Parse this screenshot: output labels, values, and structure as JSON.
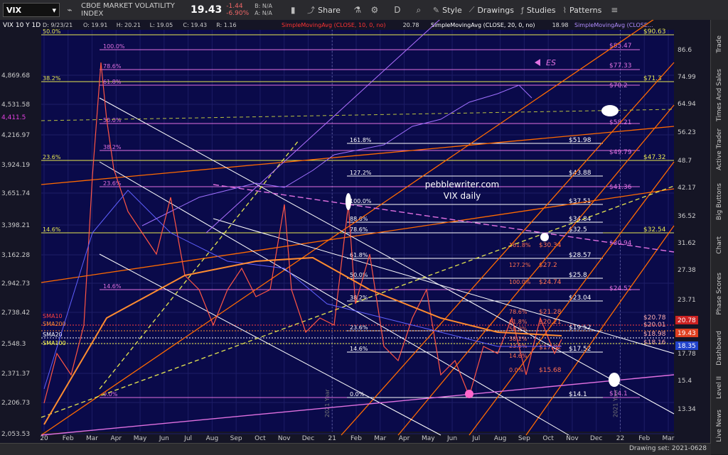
{
  "toolbar": {
    "symbol": "VIX",
    "description": "CBOE MARKET VOLATILITY INDEX",
    "price": "19.43",
    "change": "-1.44",
    "change_pct": "-6.90%",
    "bid": "B: N/A",
    "ask": "A: N/A",
    "share": "Share",
    "interval": "D",
    "style": "Style",
    "drawings": "Drawings",
    "studies": "Studies",
    "patterns": "Patterns"
  },
  "sidebar_tabs": [
    "Trade",
    "Times And Sales",
    "Active Trader",
    "Big Buttons",
    "Chart",
    "Phase Scores",
    "Dashboard",
    "Level II",
    "Live News"
  ],
  "status": {
    "drawing_set": "Drawing set: 2021-0628"
  },
  "chart_data": {
    "type": "line",
    "header": "VIX 10 Y 1D",
    "ohlc_text": [
      "D: 9/23/21",
      "O: 19.91",
      "H: 20.21",
      "L: 19.05",
      "C: 19.43",
      "R: 1.16"
    ],
    "study_labels": [
      {
        "text": "SimpleMovingAvg (CLOSE, 10, 0, no)",
        "value": "20.78",
        "color": "#ff3333"
      },
      {
        "text": "SimpleMovingAvg (CLOSE, 20, 0, no)",
        "value": "18.98",
        "color": "#ffffff"
      },
      {
        "text": "SimpleMovingAvg (CLOSE...",
        "value": "",
        "color": "#b08cff"
      }
    ],
    "x_ticks": [
      "20",
      "Feb",
      "Mar",
      "Apr",
      "May",
      "Jun",
      "Jul",
      "Aug",
      "Sep",
      "Oct",
      "Nov",
      "Dec",
      "21",
      "Feb",
      "Mar",
      "Apr",
      "May",
      "Jun",
      "Jul",
      "Aug",
      "Sep",
      "Oct",
      "Nov",
      "Dec",
      "22",
      "Feb",
      "Mar"
    ],
    "year_markers": [
      "2021 Year",
      "2021 Year"
    ],
    "left_axis": [
      "4,869.68",
      "4,531.58",
      "4,216.97",
      "3,924.19",
      "3,651.74",
      "3,398.21",
      "3,162.28",
      "2,942.73",
      "2,738.42",
      "2,548.3",
      "2,371.37",
      "2,206.73",
      "2,053.53"
    ],
    "left_highlight": {
      "text": "4,411.5",
      "color": "#e040e0"
    },
    "right_axis": [
      "86.6",
      "74.99",
      "64.94",
      "56.23",
      "48.7",
      "42.17",
      "36.52",
      "31.62",
      "27.38",
      "23.71",
      "17.78",
      "15.4",
      "13.34"
    ],
    "right_flags": [
      {
        "text": "20.78",
        "color": "#cc2222"
      },
      {
        "text": "19.43",
        "color": "#e04020"
      },
      {
        "text": "18.35",
        "color": "#2244cc"
      }
    ],
    "ma_labels": [
      {
        "text": "SMA10",
        "color": "#ff4040"
      },
      {
        "text": "SMA200",
        "color": "#ff8c30"
      },
      {
        "text": "SMA20",
        "color": "#ffffff"
      },
      {
        "text": "SMA100",
        "color": "#ffff50"
      }
    ],
    "fib_left_yellow": [
      "50.0%",
      "38.2%",
      "23.6%",
      "14.6%"
    ],
    "fib_magenta": [
      "100.0%",
      "78.6%",
      "61.8%",
      "50.0%",
      "38.2%",
      "23.6%",
      "14.6%",
      "0.0%"
    ],
    "fib_white": [
      "161.8%",
      "127.2%",
      "100.0%",
      "88.6%",
      "78.6%",
      "61.8%",
      "50.0%",
      "38.2%",
      "23.6%",
      "14.6%",
      "0.0%"
    ],
    "fib_orange": [
      "161.8%",
      "127.2%",
      "100.0%",
      "78.6%",
      "61.8%",
      "50.0%",
      "38.2%",
      "23.6%",
      "14.6%",
      "0.0%"
    ],
    "level_white": [
      "$51.98",
      "$43.88",
      "$37.51",
      "$34.84",
      "$32.5",
      "$28.57",
      "$25.8",
      "$23.04",
      "$19.52",
      "$17.52",
      "$14.1"
    ],
    "level_magenta": [
      "$85.47",
      "$77.33",
      "$70.2",
      "$58.21",
      "$49.79",
      "$41.36",
      "$30.94",
      "$24.52",
      "$14.1"
    ],
    "level_yellow": [
      "$90.63",
      "$71.3",
      "$47.32",
      "$32.54"
    ],
    "level_orange": [
      "$30.34",
      "$27.2",
      "$24.74",
      "$21.28",
      "$20.21",
      "$17.82",
      "$15.68"
    ],
    "partial_labels": [
      "$20.78",
      "$20.01",
      "$18.98",
      "$18.16"
    ],
    "annotations": [
      "pebblewriter.com",
      "VIX daily",
      "ES"
    ],
    "colors": {
      "background": "#0a0a4a",
      "up": "#22cc22",
      "down": "#ff3333",
      "fib_magenta": "#e070e0",
      "fib_yellow": "#e8e850",
      "channel": "#ff6a00",
      "spx": "#a070ff"
    }
  }
}
